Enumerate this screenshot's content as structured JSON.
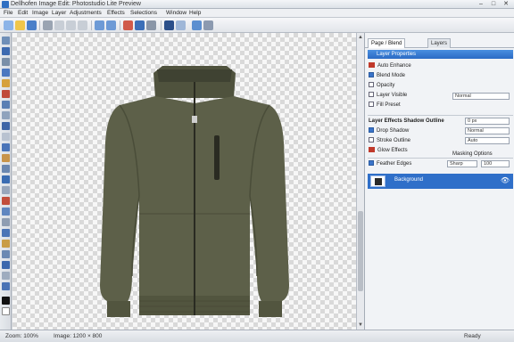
{
  "window": {
    "title": "Dellhofen Image Edit: Photostudio Lite Preview",
    "buttons": {
      "minimize": "–",
      "maximize": "□",
      "close": "✕"
    }
  },
  "menu": [
    "File",
    "Edit",
    "Image",
    "Layer",
    "Adjustments",
    "Effects",
    "Selections",
    "Window",
    "Help"
  ],
  "canvas": {
    "subject": "olive jacket with zipper on transparent background"
  },
  "panel": {
    "tabs": [
      "Page / Blend",
      "Layers"
    ],
    "header": "Layer Properties",
    "rows": [
      "Auto Enhance",
      "Blend Mode",
      "Opacity",
      "Layer Visible",
      "Fill Preset"
    ],
    "dropdown_value": "Normal",
    "section2_title": "Layer Effects  Shadow Outline",
    "section2_rows": [
      "Drop Shadow",
      "Stroke Outline",
      "Glow Effects"
    ],
    "section2_fields": [
      "0 px",
      "Normal",
      "Auto"
    ],
    "section3_title": "Masking Options",
    "section3_row": "Feather Edges",
    "section3_field": "Sharp",
    "section3_value": "100",
    "layer_name": "Background",
    "layer_visibility": "eye"
  },
  "statusbar": {
    "left": "Zoom: 100%",
    "mid": "Image: 1200 × 800",
    "right": "Ready"
  },
  "colors": {
    "accent": "#2f6fc9",
    "jacket": "#5d6049"
  }
}
